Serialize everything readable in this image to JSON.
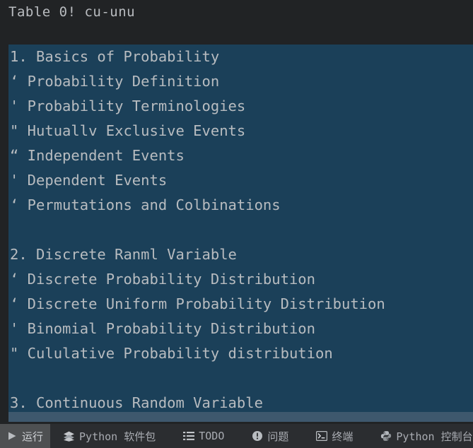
{
  "header": {
    "title": "Table 0! cu-unu"
  },
  "output": {
    "lines": [
      {
        "text": "1. Basics of Probability"
      },
      {
        "text": "‘ Probability Definition"
      },
      {
        "text": "' Probability Terminologies"
      },
      {
        "text": "\" Hutuallv Exclusive Events"
      },
      {
        "text": "“ Independent Events"
      },
      {
        "text": "' Dependent Events"
      },
      {
        "text": "‘ Permutations and Colbinations"
      },
      {
        "text": ""
      },
      {
        "text": "2. Discrete Ranml Variable"
      },
      {
        "text": "‘ Discrete Probability Distribution"
      },
      {
        "text": "‘ Discrete Uniform Probability Distribution"
      },
      {
        "text": "' Binomial Probability Distribution"
      },
      {
        "text": "\" Cululative Probability distribution"
      },
      {
        "text": ""
      },
      {
        "text": "3. Continuous Random Variable"
      }
    ]
  },
  "toolbar": {
    "items": [
      {
        "label": "运行",
        "icon": "play-icon",
        "active": true
      },
      {
        "label": "Python 软件包",
        "icon": "packages-icon",
        "active": false
      },
      {
        "label": "TODO",
        "icon": "todo-list-icon",
        "active": false
      },
      {
        "label": "问题",
        "icon": "problems-warning-icon",
        "active": false
      },
      {
        "label": "终端",
        "icon": "terminal-icon",
        "active": false
      },
      {
        "label": "Python 控制台",
        "icon": "python-icon",
        "active": false
      }
    ]
  },
  "colors": {
    "app_background": "#212325",
    "selection_background": "#1b4059",
    "text": "#b8bcc0",
    "toolbar_background": "#2b2d30",
    "toolbar_active": "#4e5052",
    "scrollbar": "#3e586d"
  }
}
